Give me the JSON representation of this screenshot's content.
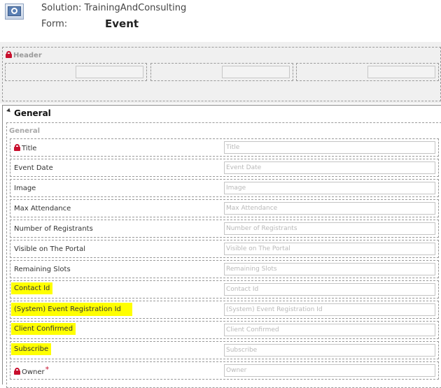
{
  "solution": "Solution: TrainingAndConsulting",
  "form_label": "Form:",
  "form_name": "Event",
  "header": {
    "title": "Header"
  },
  "tab": {
    "title": "General"
  },
  "section": {
    "title": "General"
  },
  "fields": [
    {
      "label": "Title",
      "placeholder": "Title",
      "locked": true,
      "highlighted": false
    },
    {
      "label": "Event Date",
      "placeholder": "Event Date",
      "locked": false,
      "highlighted": false
    },
    {
      "label": "Image",
      "placeholder": "Image",
      "locked": false,
      "highlighted": false
    },
    {
      "label": "Max Attendance",
      "placeholder": "Max Attendance",
      "locked": false,
      "highlighted": false
    },
    {
      "label": "Number of Registrants",
      "placeholder": "Number of Registrants",
      "locked": false,
      "highlighted": false
    },
    {
      "label": "Visible on The Portal",
      "placeholder": "Visible on The Portal",
      "locked": false,
      "highlighted": false
    },
    {
      "label": "Remaining Slots",
      "placeholder": "Remaining Slots",
      "locked": false,
      "highlighted": false
    },
    {
      "label": "Contact Id",
      "placeholder": "Contact Id",
      "locked": false,
      "highlighted": true
    },
    {
      "label": "(System) Event Registration Id",
      "placeholder": "(System) Event Registration Id",
      "locked": false,
      "highlighted": true
    },
    {
      "label": "Client Confirmed",
      "placeholder": "Client Confirmed",
      "locked": false,
      "highlighted": true
    },
    {
      "label": "Subscribe",
      "placeholder": "Subscribe",
      "locked": false,
      "highlighted": true
    },
    {
      "label": "Owner",
      "placeholder": "Owner",
      "locked": true,
      "highlighted": false,
      "required": "*"
    }
  ],
  "colors": {
    "highlight": "#ffff00",
    "lock": "#c8102e",
    "required": "#c8102e"
  }
}
